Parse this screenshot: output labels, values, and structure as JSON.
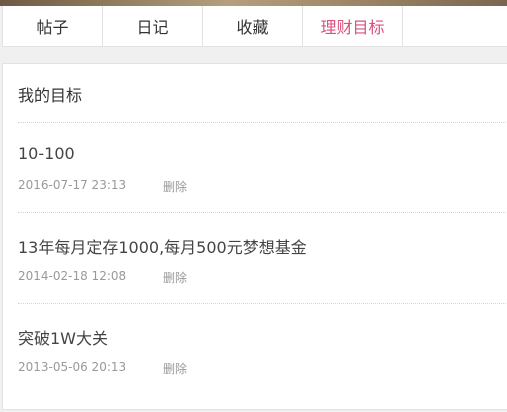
{
  "tabs": [
    {
      "label": "帖子",
      "active": false
    },
    {
      "label": "日记",
      "active": false
    },
    {
      "label": "收藏",
      "active": false
    },
    {
      "label": "理财目标",
      "active": true
    }
  ],
  "panel": {
    "title": "我的目标",
    "goals": [
      {
        "title": "10-100",
        "date": "2016-07-17 23:13",
        "delete_label": "删除"
      },
      {
        "title": "13年每月定存1000,每月500元梦想基金",
        "date": "2014-02-18 12:08",
        "delete_label": "删除"
      },
      {
        "title": "突破1W大关",
        "date": "2013-05-06 20:13",
        "delete_label": "删除"
      }
    ]
  },
  "colors": {
    "accent": "#d9527c",
    "text": "#333333",
    "muted": "#999999",
    "border": "#e2e2e2"
  }
}
